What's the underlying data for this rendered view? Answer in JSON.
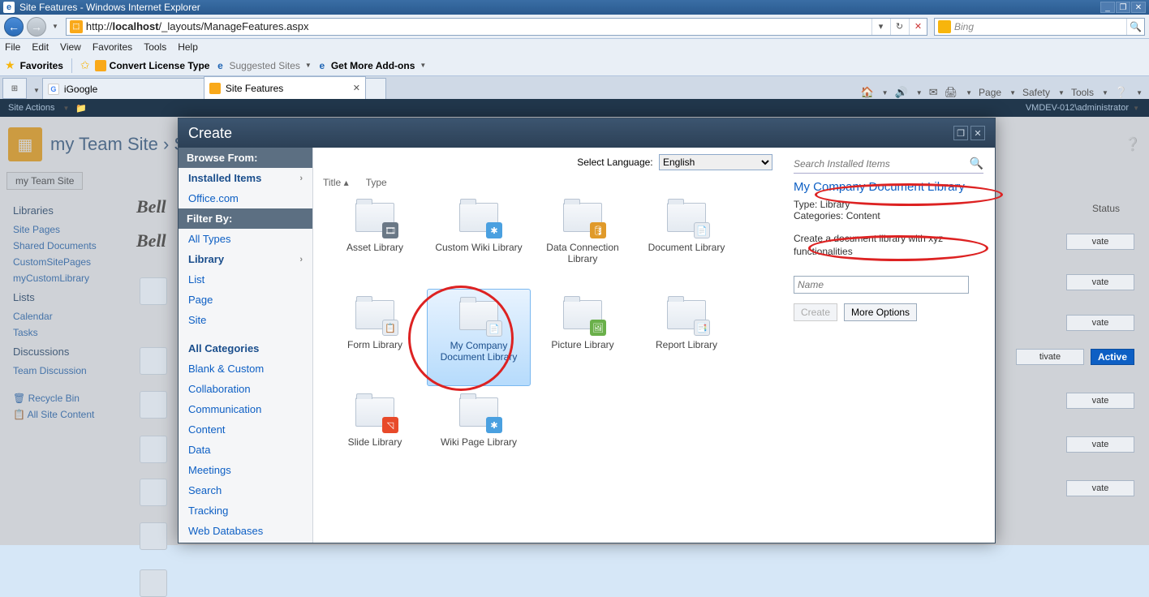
{
  "window": {
    "title": "Site Features - Windows Internet Explorer"
  },
  "nav": {
    "url_pre": "http://",
    "url_host": "localhost",
    "url_rest": "/_layouts/ManageFeatures.aspx",
    "search_engine": "Bing"
  },
  "menu": {
    "file": "File",
    "edit": "Edit",
    "view": "View",
    "favorites": "Favorites",
    "tools": "Tools",
    "help": "Help"
  },
  "favbar": {
    "favorites": "Favorites",
    "convert": "Convert License Type",
    "suggested": "Suggested Sites",
    "getmore": "Get More Add-ons"
  },
  "tabs": {
    "t0": "iGoogle",
    "t1": "Site Features"
  },
  "cmdbar": {
    "page": "Page",
    "safety": "Safety",
    "tools": "Tools"
  },
  "ribbon": {
    "site_actions": "Site Actions",
    "user": "VMDEV-012\\administrator"
  },
  "bg": {
    "breadcrumb": "my Team Site  ›  Site",
    "tab": "my Team Site",
    "nav": {
      "libraries": "Libraries",
      "site_pages": "Site Pages",
      "shared_docs": "Shared Documents",
      "custom_site_pages": "CustomSitePages",
      "my_custom_lib": "myCustomLibrary",
      "lists": "Lists",
      "calendar": "Calendar",
      "tasks": "Tasks",
      "discussions": "Discussions",
      "team_disc": "Team Discussion",
      "recycle": "Recycle Bin",
      "all_content": "All Site Content"
    },
    "bell": "Bell",
    "status": "Status",
    "activate": "vate",
    "deactivate": "tivate",
    "active": "Active"
  },
  "dialog": {
    "title": "Create",
    "browse_from": "Browse From:",
    "installed_items": "Installed Items",
    "office_com": "Office.com",
    "filter_by": "Filter By:",
    "all_types": "All Types",
    "library": "Library",
    "list": "List",
    "page": "Page",
    "site": "Site",
    "all_categories": "All Categories",
    "blank_custom": "Blank & Custom",
    "collaboration": "Collaboration",
    "communication": "Communication",
    "content": "Content",
    "data": "Data",
    "meetings": "Meetings",
    "search_cat": "Search",
    "tracking": "Tracking",
    "web_db": "Web Databases",
    "lang_label": "Select Language:",
    "lang_value": "English",
    "sort_title": "Title",
    "sort_type": "Type",
    "items": [
      {
        "label": "Asset Library"
      },
      {
        "label": "Custom Wiki Library"
      },
      {
        "label": "Data Connection Library"
      },
      {
        "label": "Document Library"
      },
      {
        "label": "Form Library"
      },
      {
        "label": "My Company Document Library"
      },
      {
        "label": "Picture Library"
      },
      {
        "label": "Report Library"
      },
      {
        "label": "Slide Library"
      },
      {
        "label": "Wiki Page Library"
      }
    ],
    "search_placeholder": "Search Installed Items",
    "right": {
      "title": "My Company Document Library",
      "type_line": "Type: Library",
      "cat_line": "Categories: Content",
      "desc": "Create a document library with xyz functionalities",
      "name_placeholder": "Name",
      "create": "Create",
      "more": "More Options"
    }
  }
}
